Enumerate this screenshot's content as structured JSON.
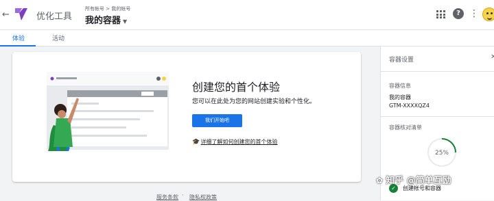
{
  "header": {
    "app_name": "优化工具",
    "breadcrumb": "所有帐号 > 我的帐号",
    "container_name": "我的容器",
    "back_icon": "arrow-back-icon",
    "logo_color": "#7b3fbf"
  },
  "tabs": [
    {
      "label": "体验",
      "active": true
    },
    {
      "label": "活动",
      "active": false
    }
  ],
  "main": {
    "title": "创建您的首个体验",
    "description": "您可以在此处为您的网站创建实验和个性化。",
    "cta_label": "我们开始吧",
    "learn_more": "详细了解如何创建您的首个体验"
  },
  "footer": {
    "terms": "服务条款",
    "separator": "·",
    "privacy": "隐私权政策"
  },
  "sidebar": {
    "title": "容器设置",
    "info_section": "容器信息",
    "container_name": "我的容器",
    "container_id": "GTM-XXXXQZ4",
    "checklist_section": "容器核对清单",
    "progress_percent": 25,
    "progress_label": "25%",
    "checklist_item": "创建帐号和容器"
  },
  "watermark": "知乎 @简单互励",
  "colors": {
    "accent": "#1a73e8",
    "success": "#188038"
  }
}
